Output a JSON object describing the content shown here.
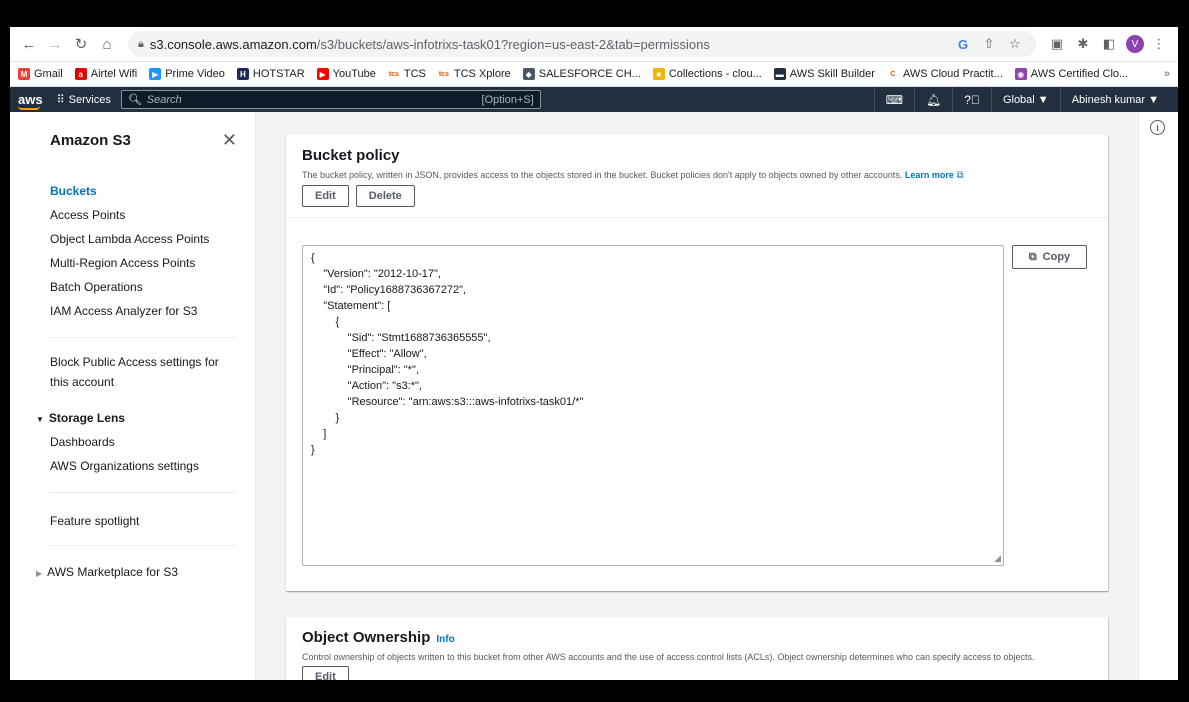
{
  "browser": {
    "url_host": "s3.console.aws.amazon.com",
    "url_path": "/s3/buckets/aws-infotrixs-task01?region=us-east-2&tab=permissions",
    "avatar_letter": "V"
  },
  "bookmarks": [
    {
      "label": "Gmail",
      "color": "#ea4335",
      "glyph": "M"
    },
    {
      "label": "Airtel Wifi",
      "color": "#e40000",
      "glyph": "a"
    },
    {
      "label": "Prime Video",
      "color": "#1a98ff",
      "glyph": "▶"
    },
    {
      "label": "HOTSTAR",
      "color": "#1f2a5a",
      "glyph": "H"
    },
    {
      "label": "YouTube",
      "color": "#ff0000",
      "glyph": "▶"
    },
    {
      "label": "TCS",
      "color": "#ffffff",
      "glyph": "tcs"
    },
    {
      "label": "TCS Xplore",
      "color": "#ffffff",
      "glyph": "tcs"
    },
    {
      "label": "SALESFORCE CH...",
      "color": "#4a5568",
      "glyph": "◆"
    },
    {
      "label": "Collections - clou...",
      "color": "#f4b400",
      "glyph": "■"
    },
    {
      "label": "AWS Skill Builder",
      "color": "#232f3e",
      "glyph": "▬"
    },
    {
      "label": "AWS Cloud Practit...",
      "color": "#ffffff",
      "glyph": "C"
    },
    {
      "label": "AWS Certified Clo...",
      "color": "#8e44ad",
      "glyph": "◉"
    }
  ],
  "aws_nav": {
    "logo": "aws",
    "services": "Services",
    "search_placeholder": "Search",
    "search_shortcut": "[Option+S]",
    "region": "Global ▼",
    "user": "Abinesh kumar ▼"
  },
  "sidebar": {
    "title": "Amazon S3",
    "items": [
      "Buckets",
      "Access Points",
      "Object Lambda Access Points",
      "Multi-Region Access Points",
      "Batch Operations",
      "IAM Access Analyzer for S3"
    ],
    "block_public_access": "Block Public Access settings for this account",
    "storage_lens": "Storage Lens",
    "storage_lens_items": [
      "Dashboards",
      "AWS Organizations settings"
    ],
    "feature_spotlight": "Feature spotlight",
    "marketplace": "AWS Marketplace for S3"
  },
  "policy": {
    "title": "Bucket policy",
    "description": "The bucket policy, written in JSON, provides access to the objects stored in the bucket. Bucket policies don't apply to objects owned by other accounts.",
    "learn_more": "Learn more",
    "edit_label": "Edit",
    "delete_label": "Delete",
    "copy_label": "Copy",
    "json_text": "{\n    \"Version\": \"2012-10-17\",\n    \"Id\": \"Policy1688736367272\",\n    \"Statement\": [\n        {\n            \"Sid\": \"Stmt1688736365555\",\n            \"Effect\": \"Allow\",\n            \"Principal\": \"*\",\n            \"Action\": \"s3:*\",\n            \"Resource\": \"arn:aws:s3:::aws-infotrixs-task01/*\"\n        }\n    ]\n}"
  },
  "ownership": {
    "title": "Object Ownership",
    "info": "Info",
    "description": "Control ownership of objects written to this bucket from other AWS accounts and the use of access control lists (ACLs). Object ownership determines who can specify access to objects.",
    "edit_label": "Edit"
  }
}
